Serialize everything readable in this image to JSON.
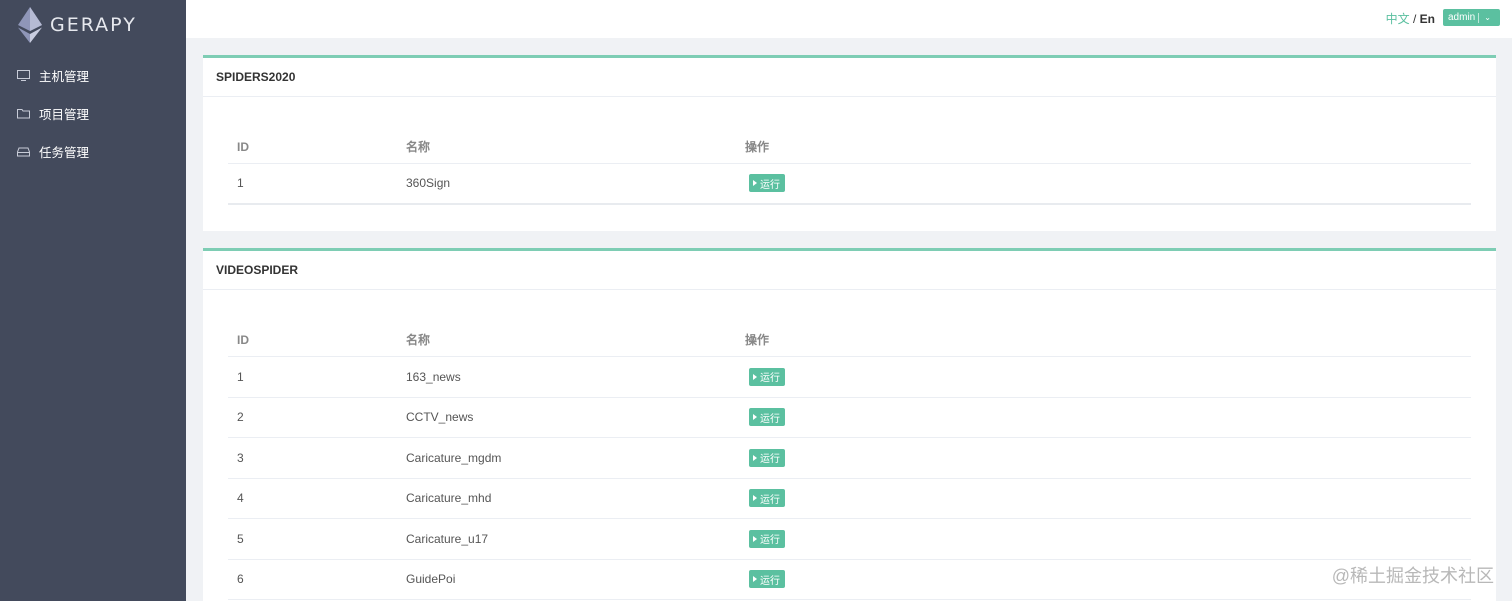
{
  "sidebar": {
    "logo_text": "GERAPY",
    "items": [
      {
        "label": "主机管理",
        "icon": "monitor-icon"
      },
      {
        "label": "项目管理",
        "icon": "folder-icon"
      },
      {
        "label": "任务管理",
        "icon": "inbox-icon"
      }
    ]
  },
  "header": {
    "lang_zh": "中文",
    "lang_sep": " / ",
    "lang_en": "En",
    "user_label": "admin"
  },
  "projects": [
    {
      "title": "SPIDERS2020",
      "columns": {
        "id": "ID",
        "name": "名称",
        "op": "操作"
      },
      "rows": [
        {
          "id": "1",
          "name": "360Sign",
          "action": "运行"
        }
      ]
    },
    {
      "title": "VIDEOSPIDER",
      "columns": {
        "id": "ID",
        "name": "名称",
        "op": "操作"
      },
      "rows": [
        {
          "id": "1",
          "name": "163_news",
          "action": "运行"
        },
        {
          "id": "2",
          "name": "CCTV_news",
          "action": "运行"
        },
        {
          "id": "3",
          "name": "Caricature_mgdm",
          "action": "运行"
        },
        {
          "id": "4",
          "name": "Caricature_mhd",
          "action": "运行"
        },
        {
          "id": "5",
          "name": "Caricature_u17",
          "action": "运行"
        },
        {
          "id": "6",
          "name": "GuidePoi",
          "action": "运行"
        }
      ]
    }
  ],
  "watermark": "@稀土掘金技术社区",
  "colors": {
    "sidebar_bg": "#434a5c",
    "accent": "#5bc0a0",
    "card_border": "#7ecdb4"
  }
}
